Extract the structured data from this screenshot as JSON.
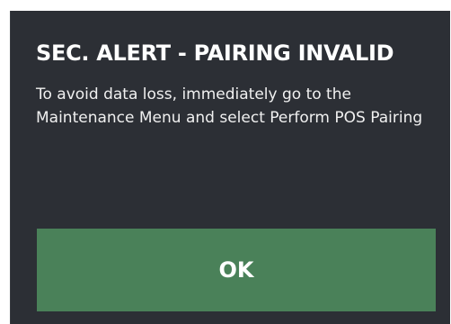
{
  "dialog": {
    "title": "SEC. ALERT - PAIRING INVALID",
    "message": "To avoid data loss, immediately go to the Maintenance Menu and select Perform POS Pairing",
    "ok_label": "OK"
  },
  "colors": {
    "dialog_background": "#2c2f35",
    "button_background": "#4a8159",
    "text": "#ffffff"
  }
}
